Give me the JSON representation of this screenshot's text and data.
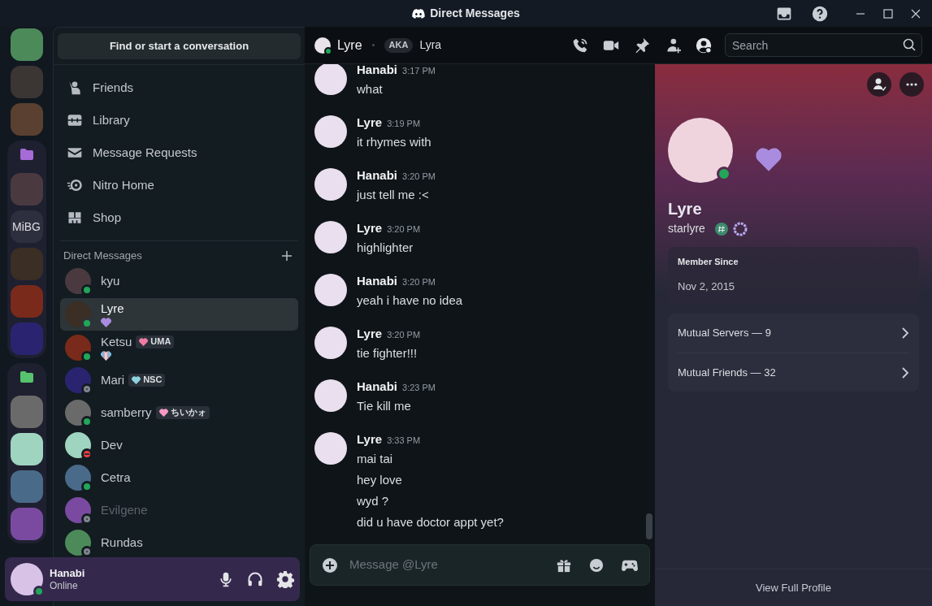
{
  "window": {
    "title": "Direct Messages"
  },
  "server_rail": [
    {
      "kind": "image"
    },
    {
      "kind": "image"
    },
    {
      "kind": "image"
    },
    {
      "kind": "folder",
      "color": "#a56bd6",
      "children": [
        {
          "kind": "image"
        },
        {
          "kind": "text",
          "label": "MiBG"
        },
        {
          "kind": "image"
        },
        {
          "kind": "image"
        },
        {
          "kind": "image"
        }
      ]
    },
    {
      "kind": "folder",
      "color": "#57c26e",
      "children": [
        {
          "kind": "image"
        },
        {
          "kind": "image"
        },
        {
          "kind": "image"
        },
        {
          "kind": "image"
        }
      ]
    }
  ],
  "search_button": "Find or start a conversation",
  "nav": [
    {
      "kind": "friends",
      "label": "Friends"
    },
    {
      "kind": "library",
      "label": "Library"
    },
    {
      "kind": "requests",
      "label": "Message Requests"
    },
    {
      "kind": "nitro",
      "label": "Nitro Home"
    },
    {
      "kind": "shop",
      "label": "Shop"
    }
  ],
  "dm_header": "Direct Messages",
  "dms": [
    {
      "name": "kyu",
      "color": "#23a55a",
      "selected": false,
      "muted": false
    },
    {
      "name": "Lyre",
      "color": "#23a55a",
      "selected": true,
      "muted": false,
      "status_emoji": {
        "kind": "heart",
        "color": "#a98ce0"
      }
    },
    {
      "name": "Ketsu",
      "color": "#23a55a",
      "selected": false,
      "muted": false,
      "status_emoji": {
        "kind": "striped-heart"
      },
      "tag": {
        "color": "#f07ca4",
        "text": "UMA"
      }
    },
    {
      "name": "Mari",
      "color": "#80848e",
      "selected": false,
      "muted": false,
      "tag": {
        "color": "#8fd3e0",
        "text": "NSC"
      }
    },
    {
      "name": "samberry",
      "color": "#23a55a",
      "selected": false,
      "muted": false,
      "tag": {
        "color": "#f59ac4",
        "text": "ちいかォ"
      }
    },
    {
      "name": "Dev",
      "color": "#f23f43",
      "selected": false,
      "muted": false
    },
    {
      "name": "Cetra",
      "color": "#23a55a",
      "selected": false,
      "muted": false
    },
    {
      "name": "Evilgene",
      "color": "#80848e",
      "selected": false,
      "muted": true
    },
    {
      "name": "Rundas",
      "color": "#80848e",
      "selected": false,
      "muted": false
    }
  ],
  "user_panel": {
    "name": "Hanabi",
    "status_text": "Online",
    "color": "#23a55a"
  },
  "chat_header": {
    "name": "Lyre",
    "color": "#23a55a",
    "aka_label": "AKA",
    "aka": "Lyra",
    "search_placeholder": "Search"
  },
  "messages": [
    {
      "author": "Hanabi",
      "time": "3:17 PM",
      "lines": [
        "what"
      ]
    },
    {
      "author": "Lyre",
      "time": "3:19 PM",
      "lines": [
        "it rhymes with"
      ]
    },
    {
      "author": "Hanabi",
      "time": "3:20 PM",
      "lines": [
        "just tell me :<"
      ]
    },
    {
      "author": "Lyre",
      "time": "3:20 PM",
      "lines": [
        "highlighter"
      ]
    },
    {
      "author": "Hanabi",
      "time": "3:20 PM",
      "lines": [
        "yeah i have no idea"
      ]
    },
    {
      "author": "Lyre",
      "time": "3:20 PM",
      "lines": [
        "tie fighter!!!"
      ]
    },
    {
      "author": "Hanabi",
      "time": "3:23 PM",
      "lines": [
        "Tie kill me"
      ]
    },
    {
      "author": "Lyre",
      "time": "3:33 PM",
      "lines": [
        "mai tai",
        "hey love",
        "wyd ?",
        "did u have doctor appt yet?"
      ]
    }
  ],
  "composer": {
    "placeholder": "Message @Lyre"
  },
  "profile": {
    "name": "Lyre",
    "username": "starlyre",
    "color": "#23a55a",
    "member_since_label": "Member Since",
    "member_since": "Nov 2, 2015",
    "links": [
      "Mutual Servers — 9",
      "Mutual Friends — 32"
    ],
    "footer": "View Full Profile"
  }
}
